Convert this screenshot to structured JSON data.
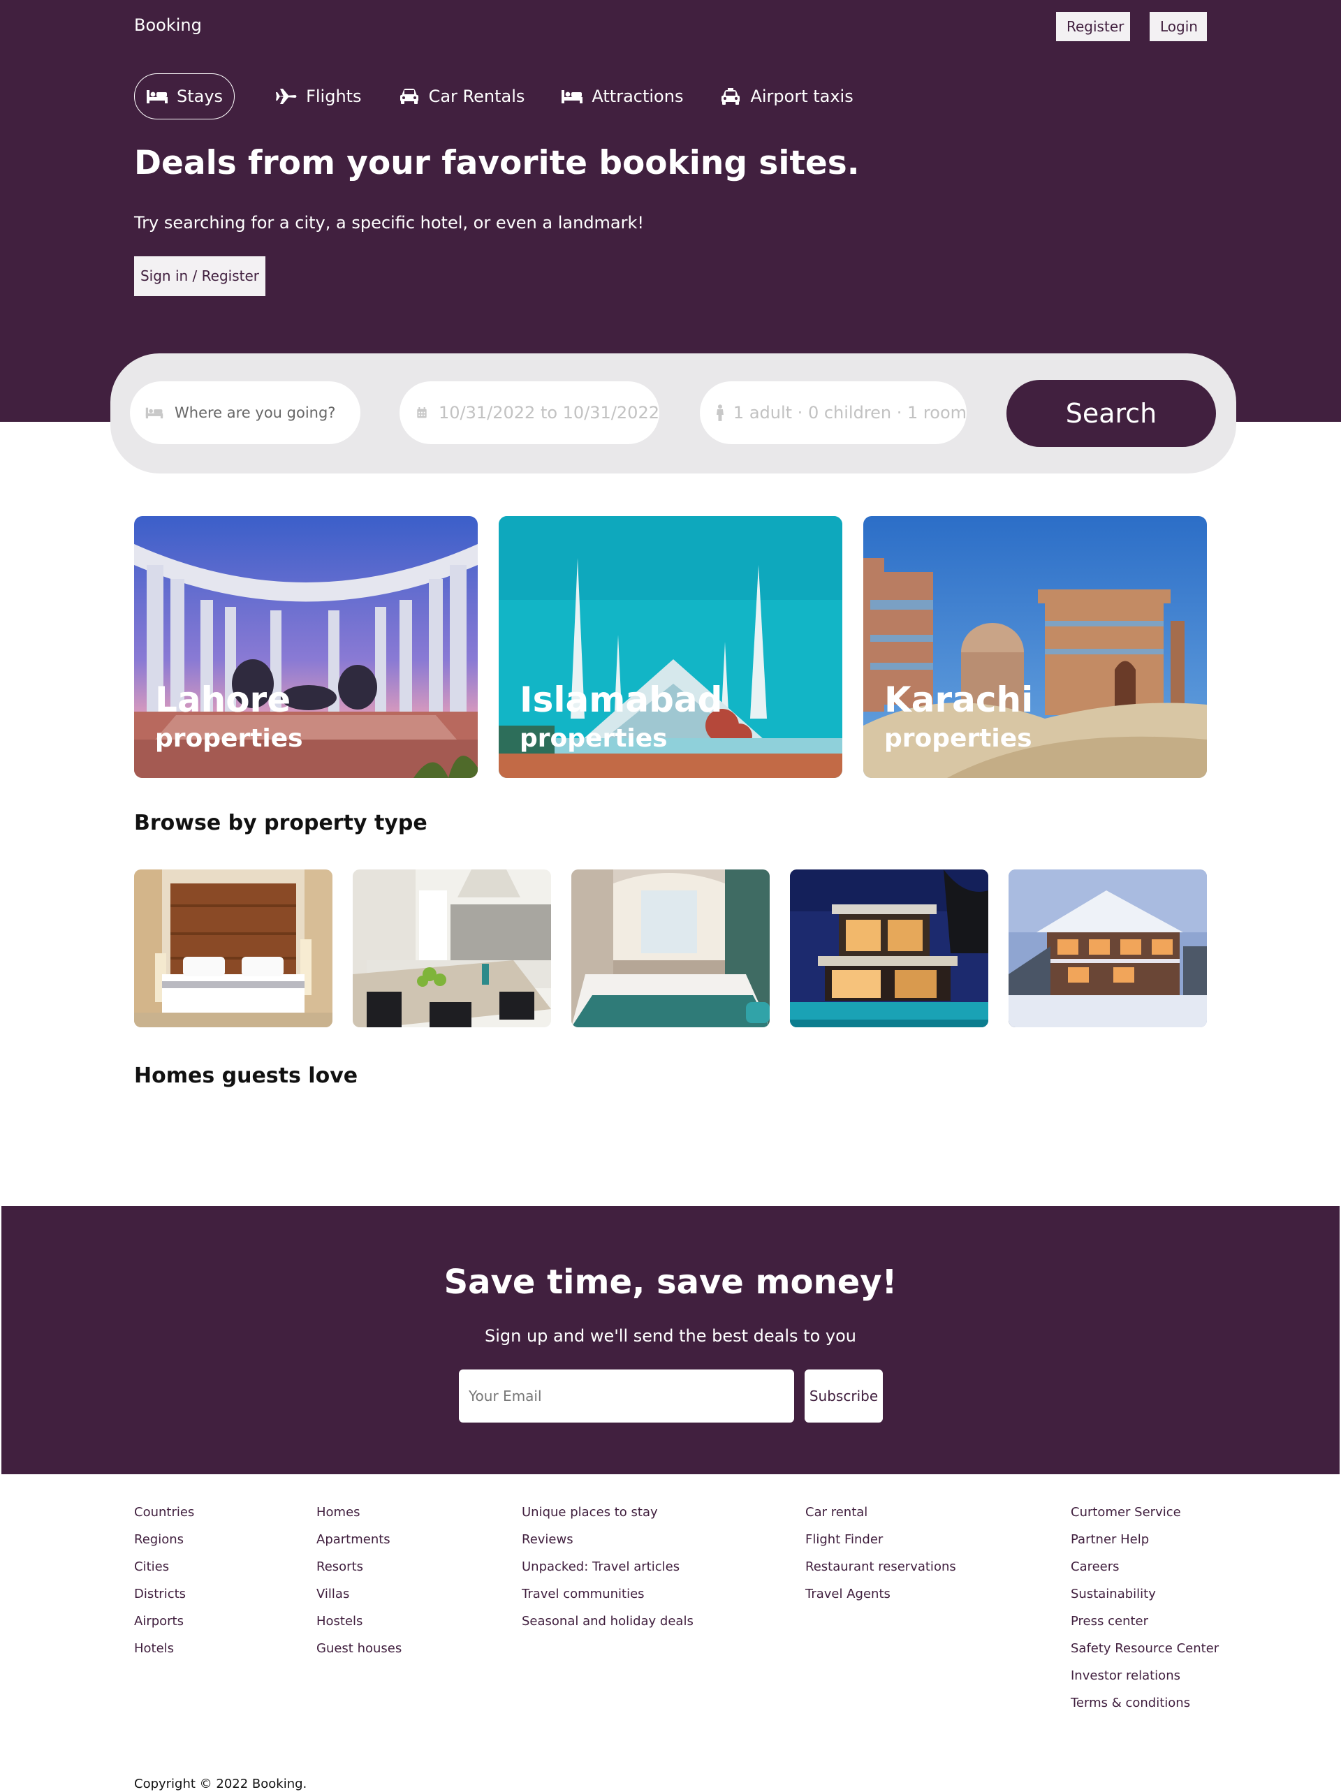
{
  "header": {
    "logo": "Booking",
    "register_label": "Register",
    "login_label": "Login",
    "nav": [
      {
        "label": "Stays",
        "icon": "bed-icon",
        "active": true
      },
      {
        "label": "Flights",
        "icon": "plane-icon"
      },
      {
        "label": "Car Rentals",
        "icon": "car-icon"
      },
      {
        "label": "Attractions",
        "icon": "bed-icon"
      },
      {
        "label": "Airport taxis",
        "icon": "taxi-icon"
      }
    ],
    "title": "Deals from your favorite booking sites.",
    "subtitle": "Try searching for a city, a specific hotel, or even a landmark!",
    "signin_label": "Sign in / Register"
  },
  "search": {
    "destination_placeholder": "Where are you going?",
    "dates": "10/31/2022 to 10/31/2022",
    "guests": "1 adult · 0 children · 1 room",
    "button_label": "Search"
  },
  "cities": [
    {
      "name": "Lahore",
      "sub": "properties"
    },
    {
      "name": "Islamabad",
      "sub": "properties"
    },
    {
      "name": "Karachi",
      "sub": "properties"
    }
  ],
  "browse_title": "Browse by property type",
  "homes_title": "Homes guests love",
  "newsletter": {
    "title": "Save time, save money!",
    "subtitle": "Sign up and we'll send the best deals to you",
    "email_placeholder": "Your Email",
    "subscribe_label": "Subscribe"
  },
  "footer": {
    "col1": [
      "Countries",
      "Regions",
      "Cities",
      "Districts",
      "Airports",
      "Hotels"
    ],
    "col2": [
      "Homes",
      "Apartments",
      "Resorts",
      "Villas",
      "Hostels",
      "Guest houses"
    ],
    "col3": [
      "Unique places to stay",
      "Reviews",
      "Unpacked: Travel articles",
      "Travel communities",
      "Seasonal and holiday deals"
    ],
    "col4": [
      "Car rental",
      "Flight Finder",
      "Restaurant reservations",
      "Travel Agents"
    ],
    "col5": [
      "Curtomer Service",
      "Partner Help",
      "Careers",
      "Sustainability",
      "Press center",
      "Safety Resource Center",
      "Investor relations",
      "Terms & conditions"
    ],
    "copyright": "Copyright © 2022 Booking."
  },
  "colors": {
    "brand": "#41203f",
    "panel": "#e9e8ea"
  }
}
